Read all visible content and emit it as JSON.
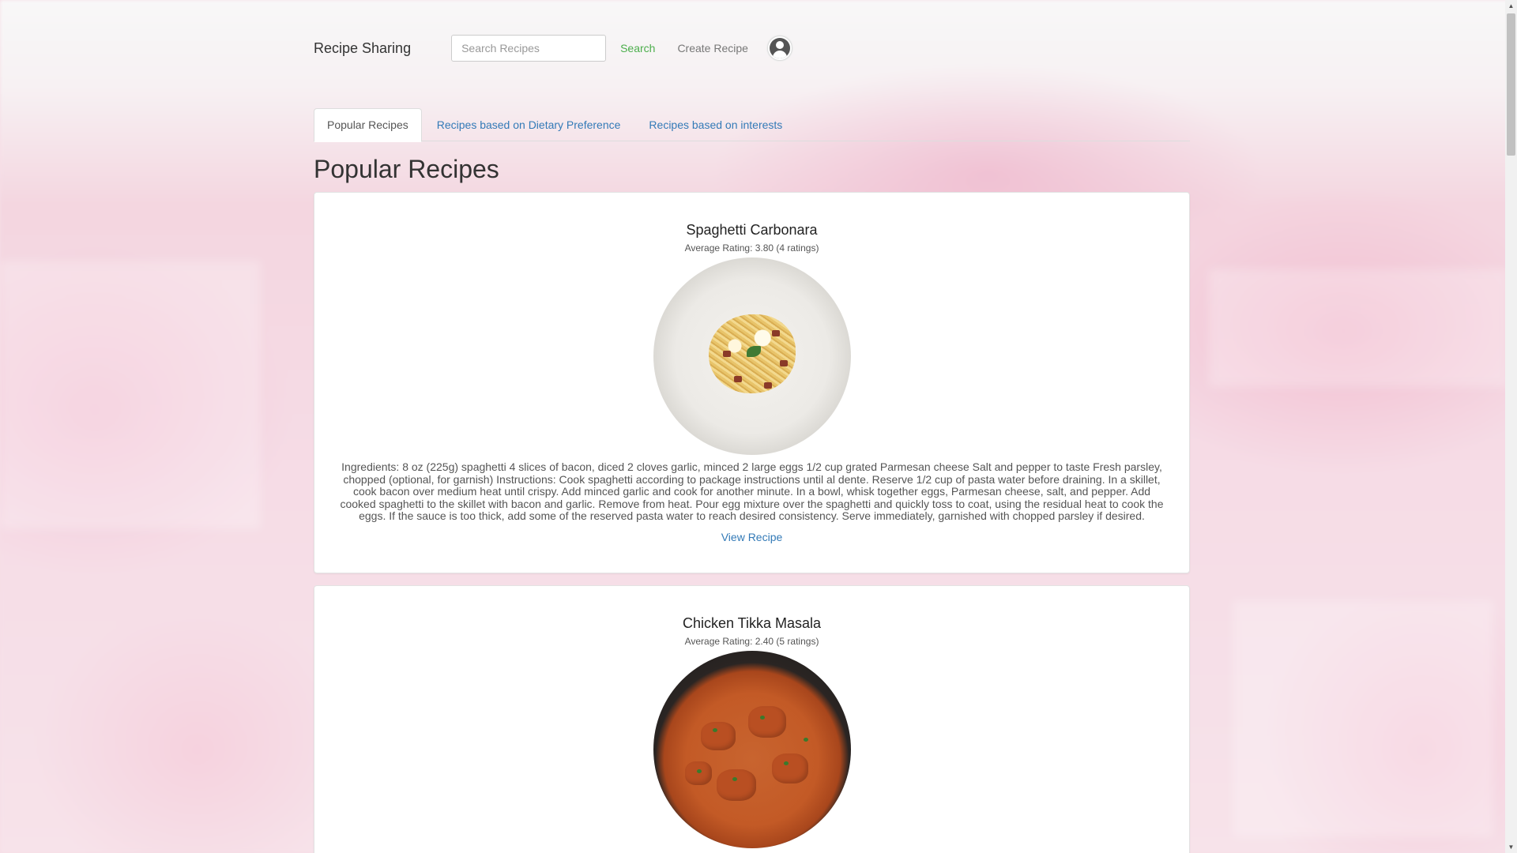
{
  "header": {
    "brand": "Recipe Sharing",
    "search_placeholder": "Search Recipes",
    "search_label": "Search",
    "create_label": "Create Recipe"
  },
  "tabs": [
    {
      "label": "Popular Recipes",
      "active": true
    },
    {
      "label": "Recipes based on Dietary Preference",
      "active": false
    },
    {
      "label": "Recipes based on interests",
      "active": false
    }
  ],
  "page_title": "Popular Recipes",
  "recipes": [
    {
      "title": "Spaghetti Carbonara",
      "rating": "Average Rating: 3.80 (4 ratings)",
      "description": "Ingredients: 8 oz (225g) spaghetti 4 slices of bacon, diced 2 cloves garlic, minced 2 large eggs 1/2 cup grated Parmesan cheese Salt and pepper to taste Fresh parsley, chopped (optional, for garnish) Instructions: Cook spaghetti according to package instructions until al dente. Reserve 1/2 cup of pasta water before draining. In a skillet, cook bacon over medium heat until crispy. Add minced garlic and cook for another minute. In a bowl, whisk together eggs, Parmesan cheese, salt, and pepper. Add cooked spaghetti to the skillet with bacon and garlic. Remove from heat. Pour egg mixture over the spaghetti and quickly toss to coat, using the residual heat to cook the eggs. If the sauce is too thick, add some of the reserved pasta water to reach desired consistency. Serve immediately, garnished with chopped parsley if desired.",
      "link": "View Recipe"
    },
    {
      "title": "Chicken Tikka Masala",
      "rating": "Average Rating: 2.40 (5 ratings)"
    }
  ],
  "colors": {
    "link": "#337ab7",
    "search": "#4cae4c"
  },
  "icons": {
    "avatar": "user-avatar-icon"
  }
}
